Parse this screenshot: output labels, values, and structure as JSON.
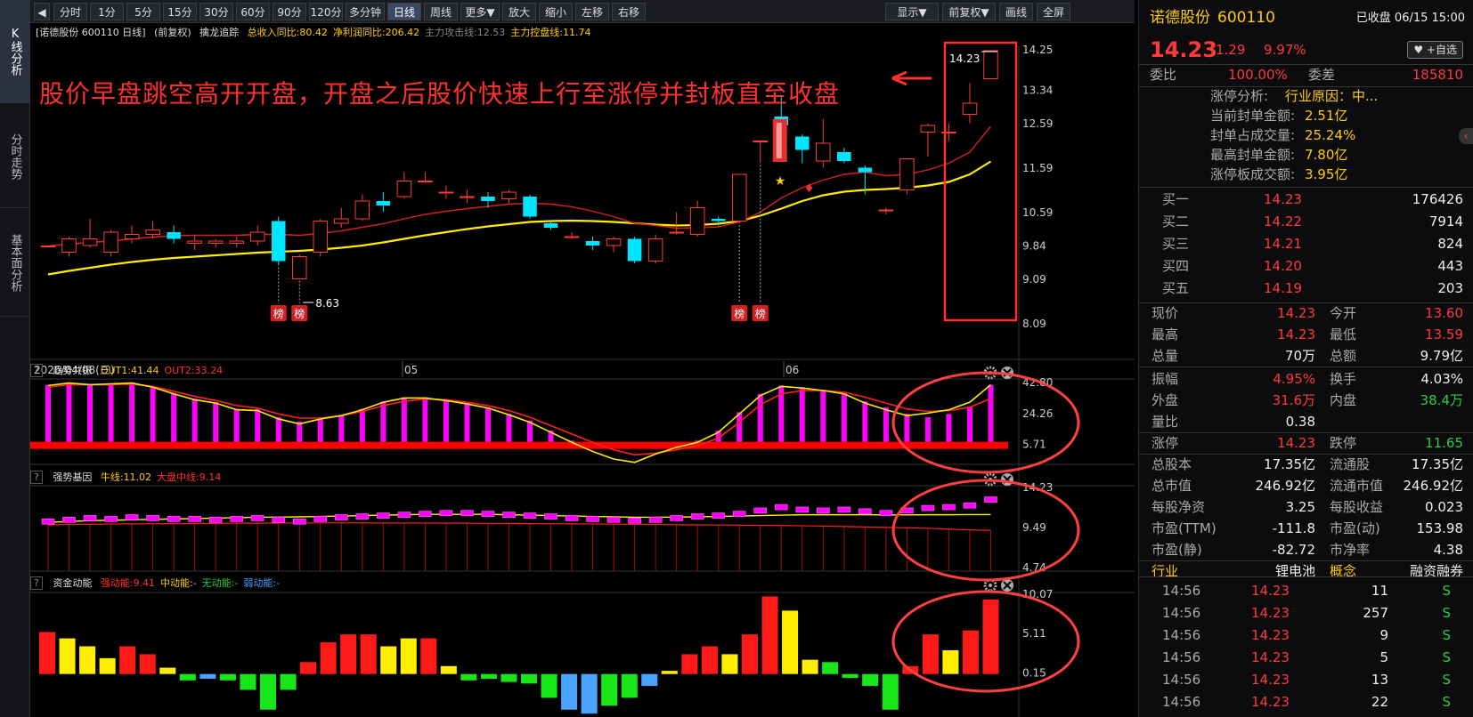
{
  "toolbar": {
    "items": [
      "分时",
      "1分",
      "5分",
      "15分",
      "30分",
      "60分",
      "90分",
      "120分",
      "多分钟",
      "日线",
      "周线",
      "更多▼",
      "放大",
      "缩小",
      "左移",
      "右移"
    ],
    "active": "日线",
    "right": [
      "显示▼",
      "前复权▼",
      "画线",
      "全屏"
    ]
  },
  "left_tabs": [
    "K线分析",
    "分时走势",
    "基本面分析"
  ],
  "main_header": {
    "title": "[诺德股份 600110 日线]",
    "mode": "(前复权)",
    "indicator": "擒龙追踪",
    "items": [
      {
        "label": "总收入同比:80.42",
        "color": "#ffcc00"
      },
      {
        "label": "净利润同比:206.42",
        "color": "#ffcc00"
      },
      {
        "label": "主力攻击线:12.53",
        "color": "#888888"
      },
      {
        "label": "主力控盘线:11.74",
        "color": "#ffcc00"
      }
    ]
  },
  "annotation": "股价早盘跳空高开开盘，开盘之后股价快速上行至涨停并封板直至收盘",
  "price_labels": [
    "14.25",
    "13.34",
    "12.59",
    "11.59",
    "10.59",
    "9.84",
    "9.09",
    "8.09"
  ],
  "date_axis": {
    "start": "2026/04/08(三)",
    "m1": "05",
    "m2": "06"
  },
  "min_label": "8.63",
  "last_label": "14.23",
  "bang": "榜",
  "sub1": {
    "name": "趋势共振",
    "items": [
      {
        "label": "OUT1:41.44",
        "color": "#ffcc00"
      },
      {
        "label": "OUT2:33.24",
        "color": "#ff3030"
      }
    ],
    "labels": [
      "42.80",
      "24.26",
      "5.71"
    ]
  },
  "sub2": {
    "name": "强势基因",
    "items": [
      {
        "label": "牛线:11.02",
        "color": "#ffcc00"
      },
      {
        "label": "大盘中线:9.14",
        "color": "#ff3030"
      }
    ],
    "labels": [
      "14.23",
      "9.49",
      "4.74"
    ]
  },
  "sub3": {
    "name": "资金动能",
    "items": [
      {
        "label": "强动能:9.41",
        "color": "#ff3030"
      },
      {
        "label": "中动能:-",
        "color": "#ffcc00"
      },
      {
        "label": "无动能:-",
        "color": "#2ecc40"
      },
      {
        "label": "弱动能:-",
        "color": "#4aa3ff"
      }
    ],
    "labels": [
      "10.07",
      "5.11",
      "0.15"
    ]
  },
  "stock": {
    "name": "诺德股份",
    "code": "600110",
    "status": "已收盘 06/15 15:00",
    "price": "14.23",
    "change": "1.29",
    "pct": "9.97%",
    "watch": "♥ +自选"
  },
  "weibi": {
    "l1": "委比",
    "v1": "100.00%",
    "l2": "委差",
    "v2": "185810"
  },
  "zt": {
    "title": "涨停分析:",
    "reason": "行业原因：中...",
    "rows": [
      {
        "k": "当前封单金额:",
        "v": "2.51亿"
      },
      {
        "k": "封单占成交量:",
        "v": "25.24%"
      },
      {
        "k": "最高封单金额:",
        "v": "7.80亿"
      },
      {
        "k": "涨停板成交额:",
        "v": "3.95亿"
      }
    ]
  },
  "bids": [
    {
      "l": "买一",
      "p": "14.23",
      "v": "176426"
    },
    {
      "l": "买二",
      "p": "14.22",
      "v": "7914"
    },
    {
      "l": "买三",
      "p": "14.21",
      "v": "824"
    },
    {
      "l": "买四",
      "p": "14.20",
      "v": "443"
    },
    {
      "l": "买五",
      "p": "14.19",
      "v": "203"
    }
  ],
  "quote": [
    [
      {
        "t": "现价",
        "c": "gry"
      },
      {
        "t": "14.23",
        "c": "red"
      },
      {
        "t": "今开",
        "c": "gry"
      },
      {
        "t": "13.60",
        "c": "red"
      }
    ],
    [
      {
        "t": "最高",
        "c": "gry"
      },
      {
        "t": "14.23",
        "c": "red"
      },
      {
        "t": "最低",
        "c": "gry"
      },
      {
        "t": "13.59",
        "c": "red"
      }
    ],
    [
      {
        "t": "总量",
        "c": "gry"
      },
      {
        "t": "70万",
        "c": "wht"
      },
      {
        "t": "总额",
        "c": "gry"
      },
      {
        "t": "9.79亿",
        "c": "wht"
      }
    ],
    [
      {
        "t": "振幅",
        "c": "gry"
      },
      {
        "t": "4.95%",
        "c": "red"
      },
      {
        "t": "换手",
        "c": "gry"
      },
      {
        "t": "4.03%",
        "c": "wht"
      }
    ],
    [
      {
        "t": "外盘",
        "c": "gry"
      },
      {
        "t": "31.6万",
        "c": "red"
      },
      {
        "t": "内盘",
        "c": "gry"
      },
      {
        "t": "38.4万",
        "c": "grn"
      }
    ],
    [
      {
        "t": "量比",
        "c": "gry"
      },
      {
        "t": "0.38",
        "c": "wht"
      },
      {
        "t": "",
        "c": "gry"
      },
      {
        "t": "",
        "c": "wht"
      }
    ],
    [
      {
        "t": "涨停",
        "c": "gry"
      },
      {
        "t": "14.23",
        "c": "red"
      },
      {
        "t": "跌停",
        "c": "gry"
      },
      {
        "t": "11.65",
        "c": "grn"
      }
    ],
    [
      {
        "t": "总股本",
        "c": "gry"
      },
      {
        "t": "17.35亿",
        "c": "wht"
      },
      {
        "t": "流通股",
        "c": "gry"
      },
      {
        "t": "17.35亿",
        "c": "wht"
      }
    ],
    [
      {
        "t": "总市值",
        "c": "gry"
      },
      {
        "t": "246.92亿",
        "c": "wht"
      },
      {
        "t": "流通市值",
        "c": "gry"
      },
      {
        "t": "246.92亿",
        "c": "wht"
      }
    ],
    [
      {
        "t": "每股净资",
        "c": "gry"
      },
      {
        "t": "3.25",
        "c": "wht"
      },
      {
        "t": "每股收益",
        "c": "gry"
      },
      {
        "t": "0.023",
        "c": "wht"
      }
    ],
    [
      {
        "t": "市盈(TTM)",
        "c": "gry"
      },
      {
        "t": "-111.8",
        "c": "wht"
      },
      {
        "t": "市盈(动)",
        "c": "gry"
      },
      {
        "t": "153.98",
        "c": "wht"
      }
    ],
    [
      {
        "t": "市盈(静)",
        "c": "gry"
      },
      {
        "t": "-82.72",
        "c": "wht"
      },
      {
        "t": "市净率",
        "c": "gry"
      },
      {
        "t": "4.38",
        "c": "wht"
      }
    ],
    [
      {
        "t": "行业",
        "c": "yel"
      },
      {
        "t": "锂电池",
        "c": "wht"
      },
      {
        "t": "概念",
        "c": "yel"
      },
      {
        "t": "融资融券",
        "c": "wht"
      }
    ]
  ],
  "trades": [
    {
      "t": "14:56",
      "p": "14.23",
      "v": "11",
      "d": "S"
    },
    {
      "t": "14:56",
      "p": "14.23",
      "v": "257",
      "d": "S"
    },
    {
      "t": "14:56",
      "p": "14.23",
      "v": "9",
      "d": "S"
    },
    {
      "t": "14:56",
      "p": "14.23",
      "v": "5",
      "d": "S"
    },
    {
      "t": "14:56",
      "p": "14.23",
      "v": "13",
      "d": "S"
    },
    {
      "t": "14:56",
      "p": "14.23",
      "v": "22",
      "d": "S"
    }
  ],
  "chart_data": {
    "type": "candlestick",
    "candles": [
      [
        9.84,
        9.84,
        9.84,
        9.84
      ],
      [
        9.7,
        10.0,
        9.6,
        10.05
      ],
      [
        9.85,
        10.0,
        9.8,
        10.45
      ],
      [
        9.7,
        10.15,
        9.6,
        10.2
      ],
      [
        10.0,
        10.1,
        9.9,
        10.3
      ],
      [
        10.1,
        10.2,
        10.0,
        10.4
      ],
      [
        10.15,
        10.0,
        9.9,
        10.3
      ],
      [
        9.9,
        9.95,
        9.75,
        10.1
      ],
      [
        9.9,
        9.95,
        9.8,
        10.0
      ],
      [
        9.9,
        9.95,
        9.8,
        10.05
      ],
      [
        9.95,
        10.15,
        9.85,
        10.3
      ],
      [
        10.4,
        9.5,
        9.4,
        10.5
      ],
      [
        9.1,
        9.6,
        9.1,
        9.65
      ],
      [
        9.7,
        10.4,
        9.6,
        10.45
      ],
      [
        10.35,
        10.45,
        10.25,
        10.7
      ],
      [
        10.45,
        10.85,
        10.4,
        11.0
      ],
      [
        10.85,
        10.75,
        10.6,
        11.05
      ],
      [
        10.95,
        11.3,
        10.9,
        11.5
      ],
      [
        11.3,
        11.3,
        11.25,
        11.5
      ],
      [
        11.05,
        11.05,
        10.9,
        11.2
      ],
      [
        10.95,
        10.95,
        10.8,
        11.1
      ],
      [
        10.95,
        10.85,
        10.7,
        11.05
      ],
      [
        10.9,
        11.05,
        10.8,
        11.1
      ],
      [
        10.95,
        10.5,
        10.45,
        11.0
      ],
      [
        10.35,
        10.25,
        10.2,
        10.4
      ],
      [
        10.05,
        10.05,
        10.0,
        10.15
      ],
      [
        9.95,
        9.85,
        9.75,
        10.05
      ],
      [
        9.85,
        10.0,
        9.7,
        10.05
      ],
      [
        10.0,
        9.5,
        9.45,
        10.05
      ],
      [
        9.5,
        10.0,
        9.45,
        10.1
      ],
      [
        10.15,
        10.15,
        10.1,
        10.6
      ],
      [
        10.1,
        10.7,
        10.05,
        10.85
      ],
      [
        10.45,
        10.4,
        10.3,
        10.5
      ],
      [
        10.4,
        11.45,
        10.35,
        11.45
      ],
      [
        12.2,
        12.2,
        11.7,
        12.2
      ],
      [
        12.75,
        12.55,
        12.4,
        13.2
      ],
      [
        12.3,
        12.0,
        11.7,
        12.35
      ],
      [
        11.75,
        12.15,
        11.6,
        12.7
      ],
      [
        11.95,
        11.75,
        11.7,
        12.05
      ],
      [
        11.6,
        11.5,
        11.0,
        11.65
      ],
      [
        10.65,
        10.65,
        10.55,
        10.7
      ],
      [
        11.1,
        11.8,
        11.0,
        11.8
      ],
      [
        12.4,
        12.55,
        11.85,
        12.6
      ],
      [
        12.4,
        12.4,
        12.2,
        12.6
      ],
      [
        12.8,
        13.05,
        12.6,
        13.5
      ],
      [
        13.6,
        14.23,
        13.59,
        14.23
      ]
    ],
    "ma_red": [
      9.84,
      9.88,
      9.92,
      9.95,
      10.0,
      10.04,
      10.07,
      10.08,
      10.08,
      10.08,
      10.1,
      10.1,
      10.08,
      10.12,
      10.18,
      10.26,
      10.34,
      10.45,
      10.55,
      10.62,
      10.68,
      10.73,
      10.78,
      10.8,
      10.78,
      10.72,
      10.62,
      10.5,
      10.35,
      10.3,
      10.24,
      10.25,
      10.27,
      10.38,
      10.6,
      10.92,
      11.15,
      11.32,
      11.45,
      11.5,
      11.42,
      11.45,
      11.55,
      11.7,
      11.95,
      12.53
    ],
    "ma_yellow": [
      9.2,
      9.28,
      9.35,
      9.42,
      9.48,
      9.53,
      9.57,
      9.6,
      9.63,
      9.66,
      9.69,
      9.71,
      9.73,
      9.76,
      9.8,
      9.85,
      9.92,
      10.0,
      10.08,
      10.15,
      10.22,
      10.28,
      10.33,
      10.38,
      10.4,
      10.41,
      10.4,
      10.38,
      10.35,
      10.32,
      10.3,
      10.31,
      10.34,
      10.4,
      10.52,
      10.68,
      10.85,
      10.98,
      11.06,
      11.1,
      11.12,
      11.15,
      11.2,
      11.28,
      11.45,
      11.74
    ],
    "sub1_bars": [
      41.4,
      42.8,
      41.8,
      42.3,
      42.8,
      40.5,
      36.5,
      33.0,
      31.0,
      27.0,
      27.0,
      22.0,
      19.5,
      21.5,
      23.5,
      27.0,
      31.5,
      34.0,
      34.0,
      32.5,
      30.5,
      28.0,
      24.0,
      20.0,
      14.0,
      8.0,
      3.0,
      -2.0,
      -3.5,
      1.5,
      5.0,
      8.0,
      14.0,
      25.0,
      36.0,
      41.0,
      40.0,
      38.5,
      36.5,
      31.5,
      28.0,
      24.0,
      22.0,
      24.0,
      28.5,
      41.44
    ],
    "sub1_yellow": [
      41.0,
      42.5,
      41.5,
      42.0,
      42.5,
      40.0,
      36.0,
      32.5,
      30.5,
      26.5,
      26.0,
      21.0,
      18.0,
      21.0,
      23.0,
      26.5,
      31.0,
      33.5,
      33.5,
      32.0,
      30.0,
      27.5,
      23.5,
      19.0,
      13.0,
      7.0,
      1.5,
      -3.0,
      -5.0,
      0.0,
      4.0,
      7.0,
      13.0,
      24.0,
      35.0,
      40.5,
      39.5,
      38.0,
      36.0,
      30.5,
      26.5,
      23.0,
      24.5,
      26.5,
      31.0,
      41.44
    ],
    "sub1_red": [
      40.0,
      41.5,
      41.5,
      41.5,
      41.8,
      40.5,
      37.5,
      34.5,
      32.0,
      29.0,
      27.5,
      24.0,
      21.5,
      21.5,
      23.0,
      25.5,
      29.0,
      31.5,
      33.0,
      32.5,
      31.0,
      29.0,
      26.0,
      22.0,
      17.0,
      12.0,
      7.0,
      2.5,
      -0.5,
      0.5,
      2.5,
      5.0,
      9.5,
      19.0,
      29.5,
      36.0,
      38.0,
      38.0,
      37.0,
      34.0,
      30.5,
      27.0,
      25.5,
      26.0,
      28.0,
      33.24
    ],
    "sub2_boxes": [
      10.2,
      10.4,
      10.6,
      10.5,
      10.7,
      10.6,
      10.5,
      10.5,
      10.4,
      10.5,
      10.6,
      10.4,
      10.2,
      10.5,
      10.7,
      10.8,
      10.9,
      11.0,
      11.1,
      11.2,
      11.2,
      11.1,
      11.0,
      10.9,
      10.8,
      10.6,
      10.5,
      10.4,
      10.3,
      10.4,
      10.6,
      10.8,
      10.9,
      11.1,
      11.5,
      11.9,
      11.6,
      11.5,
      11.6,
      11.4,
      11.2,
      11.5,
      11.8,
      11.9,
      12.1,
      12.8
    ],
    "sub2_yellow": [
      10.1,
      10.2,
      10.3,
      10.35,
      10.4,
      10.45,
      10.5,
      10.55,
      10.6,
      10.65,
      10.7,
      10.72,
      10.75,
      10.8,
      10.85,
      10.9,
      10.95,
      11.0,
      11.05,
      11.05,
      11.05,
      11.05,
      11.0,
      10.95,
      10.9,
      10.85,
      10.8,
      10.75,
      10.7,
      10.7,
      10.72,
      10.75,
      10.8,
      10.85,
      10.9,
      10.95,
      11.0,
      11.0,
      11.0,
      11.0,
      10.98,
      10.98,
      11.0,
      11.0,
      11.02,
      11.02
    ],
    "sub2_red": [
      9.8,
      9.85,
      9.88,
      9.9,
      9.92,
      9.94,
      9.95,
      9.97,
      9.98,
      10.0,
      10.0,
      10.02,
      10.02,
      10.03,
      10.03,
      10.03,
      10.02,
      10.02,
      10.02,
      10.0,
      10.0,
      9.98,
      9.97,
      9.95,
      9.94,
      9.92,
      9.9,
      9.88,
      9.86,
      9.84,
      9.82,
      9.8,
      9.78,
      9.76,
      9.74,
      9.72,
      9.7,
      9.65,
      9.6,
      9.55,
      9.5,
      9.45,
      9.4,
      9.3,
      9.2,
      9.14
    ],
    "sub3_bars": [
      5.3,
      4.5,
      3.5,
      2.0,
      3.5,
      2.5,
      0.8,
      -0.8,
      -0.6,
      -0.8,
      -2.0,
      -4.5,
      -2.0,
      1.5,
      4.0,
      5.0,
      5.0,
      3.5,
      4.5,
      4.5,
      1.0,
      -0.8,
      -0.6,
      -1.0,
      -1.2,
      -3.0,
      -4.5,
      -5.0,
      -4.0,
      -3.0,
      -1.5,
      0.4,
      2.5,
      3.5,
      2.5,
      5.0,
      9.8,
      8.0,
      1.8,
      1.5,
      -0.5,
      -1.5,
      -4.5,
      1.0,
      5.0,
      3.0,
      5.5,
      9.41
    ],
    "sub3_colors": [
      "r",
      "y",
      "y",
      "y",
      "r",
      "r",
      "y",
      "g",
      "b",
      "g",
      "g",
      "g",
      "g",
      "r",
      "r",
      "r",
      "r",
      "y",
      "y",
      "r",
      "y",
      "g",
      "g",
      "g",
      "g",
      "g",
      "b",
      "b",
      "g",
      "g",
      "b",
      "y",
      "r",
      "r",
      "y",
      "r",
      "r",
      "y",
      "y",
      "g",
      "g",
      "g",
      "g",
      "r",
      "r",
      "y",
      "r",
      "r"
    ]
  }
}
